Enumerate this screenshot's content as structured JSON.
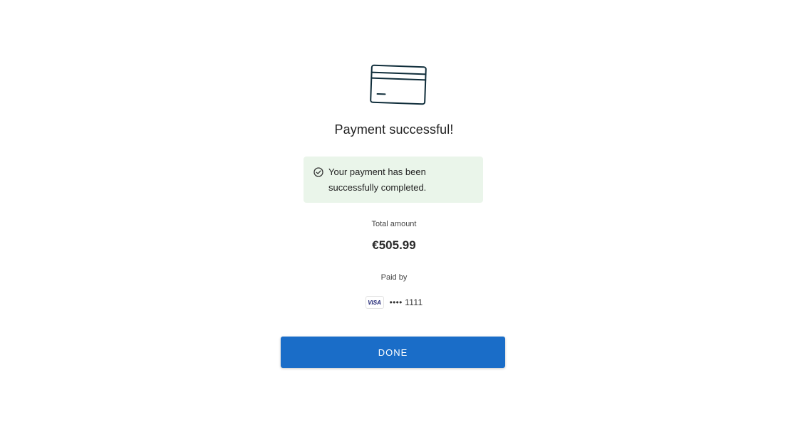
{
  "illustration": {
    "icon": "credit-card-icon",
    "stroke_color": "#0f2d3a"
  },
  "title": "Payment successful!",
  "alert": {
    "icon": "check-circle-icon",
    "message": "Your payment has been successfully completed.",
    "background_color": "#eaf5ea"
  },
  "total": {
    "label": "Total amount",
    "value": "€505.99"
  },
  "payment_method": {
    "label": "Paid by",
    "brand": "VISA",
    "masked_number": "•••• 1111"
  },
  "actions": {
    "done_label": "DONE",
    "accent_color": "#1a6dc8"
  }
}
